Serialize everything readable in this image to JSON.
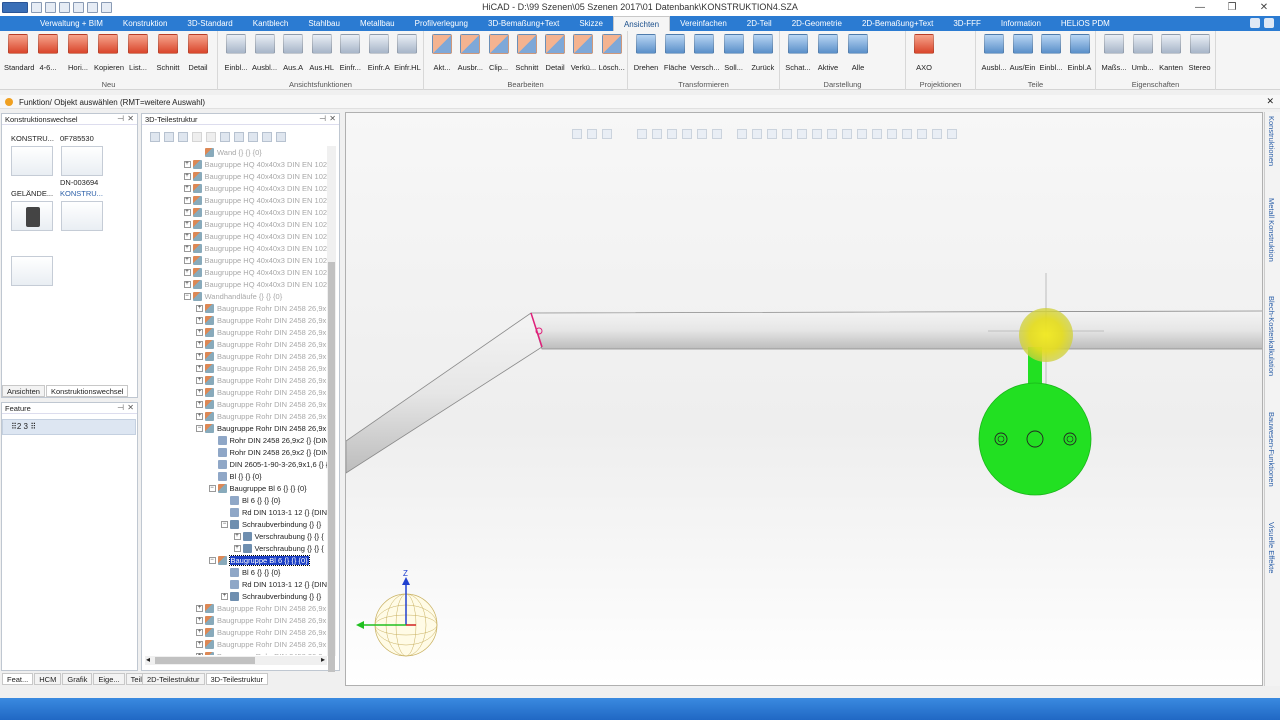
{
  "window": {
    "title": "HiCAD - D:\\99 Szenen\\05 Szenen 2017\\01 Datenbank\\KONSTRUKTION4.SZA",
    "minimize": "—",
    "restore": "❐",
    "close": "✕"
  },
  "ribbon_tabs": [
    {
      "label": "Verwaltung + BIM"
    },
    {
      "label": "Konstruktion"
    },
    {
      "label": "3D-Standard"
    },
    {
      "label": "Kantblech"
    },
    {
      "label": "Stahlbau"
    },
    {
      "label": "Metallbau"
    },
    {
      "label": "Profilverlegung"
    },
    {
      "label": "3D-Bemaßung+Text"
    },
    {
      "label": "Skizze"
    },
    {
      "label": "Ansichten"
    },
    {
      "label": "Vereinfachen"
    },
    {
      "label": "2D-Teil"
    },
    {
      "label": "2D-Geometrie"
    },
    {
      "label": "2D-Bemaßung+Text"
    },
    {
      "label": "3D-FFF"
    },
    {
      "label": "Information"
    },
    {
      "label": "HELiOS PDM"
    }
  ],
  "active_tab": "Ansichten",
  "ribbon_groups": [
    {
      "label": "Neu",
      "buttons": [
        "Standard",
        "4-6...",
        "Hori...",
        "Kopieren",
        "List...",
        "Schnitt",
        "Detail"
      ]
    },
    {
      "label": "Ansichtsfunktionen",
      "buttons": [
        "Einbl...",
        "Ausbl...",
        "Aus.A",
        "Aus.HL",
        "Einfr...",
        "Einfr.A",
        "Einfr.HL"
      ]
    },
    {
      "label": "Bearbeiten",
      "buttons": [
        "Akt...",
        "Ausbr...",
        "Clip...",
        "Schnitt",
        "Detail",
        "Verkü...",
        "Lösch..."
      ]
    },
    {
      "label": "Transformieren",
      "buttons": [
        "Drehen",
        "Fläche",
        "Versch...",
        "Soll...",
        "Zurück"
      ]
    },
    {
      "label": "Darstellung",
      "buttons": [
        "Schat...",
        "Aktive",
        "Alle"
      ]
    },
    {
      "label": "Projektionen",
      "buttons": [
        "AXO"
      ]
    },
    {
      "label": "Teile",
      "buttons": [
        "Ausbl...",
        "Aus/Ein",
        "Einbl...",
        "Einbl.A"
      ]
    },
    {
      "label": "Eigenschaften",
      "buttons": [
        "Maßs...",
        "Umb...",
        "Kanten",
        "Stereo"
      ]
    }
  ],
  "status_message": "Funktion/ Objekt auswählen (RMT=weitere Auswahl)",
  "status_close": "✕",
  "konstruktionswechsel": {
    "title": "Konstruktionswechsel",
    "pin": "⊣",
    "close": "✕",
    "items": [
      {
        "label": "KONSTRU..."
      },
      {
        "label": "0F785530"
      },
      {
        "label": "DN-003694"
      },
      {
        "label": "GELÄNDE..."
      },
      {
        "label": "KONSTRU..."
      }
    ],
    "tabs": [
      "Ansichten",
      "Konstruktionswechsel"
    ]
  },
  "feature": {
    "title": "Feature",
    "pin": "⊣",
    "close": "✕",
    "toolbar": "⠿2 3 ⠿"
  },
  "teilestruktur": {
    "title": "3D-Teilestruktur",
    "pin": "⊣",
    "close": "✕",
    "rows": [
      {
        "text": "Wand {} {} {0}",
        "indent": 2,
        "exp": "",
        "dim": true,
        "icon": "grp"
      },
      {
        "text": "Baugruppe HQ 40x40x3 DIN EN 102",
        "indent": 1,
        "exp": "+",
        "dim": true,
        "icon": "grp"
      },
      {
        "text": "Baugruppe HQ 40x40x3 DIN EN 102",
        "indent": 1,
        "exp": "+",
        "dim": true,
        "icon": "grp"
      },
      {
        "text": "Baugruppe HQ 40x40x3 DIN EN 102",
        "indent": 1,
        "exp": "+",
        "dim": true,
        "icon": "grp"
      },
      {
        "text": "Baugruppe HQ 40x40x3 DIN EN 102",
        "indent": 1,
        "exp": "+",
        "dim": true,
        "icon": "grp"
      },
      {
        "text": "Baugruppe HQ 40x40x3 DIN EN 102",
        "indent": 1,
        "exp": "+",
        "dim": true,
        "icon": "grp"
      },
      {
        "text": "Baugruppe HQ 40x40x3 DIN EN 102",
        "indent": 1,
        "exp": "+",
        "dim": true,
        "icon": "grp"
      },
      {
        "text": "Baugruppe HQ 40x40x3 DIN EN 102",
        "indent": 1,
        "exp": "+",
        "dim": true,
        "icon": "grp"
      },
      {
        "text": "Baugruppe HQ 40x40x3 DIN EN 102",
        "indent": 1,
        "exp": "+",
        "dim": true,
        "icon": "grp"
      },
      {
        "text": "Baugruppe HQ 40x40x3 DIN EN 102",
        "indent": 1,
        "exp": "+",
        "dim": true,
        "icon": "grp"
      },
      {
        "text": "Baugruppe HQ 40x40x3 DIN EN 102",
        "indent": 1,
        "exp": "+",
        "dim": true,
        "icon": "grp"
      },
      {
        "text": "Baugruppe HQ 40x40x3 DIN EN 102",
        "indent": 1,
        "exp": "+",
        "dim": true,
        "icon": "grp"
      },
      {
        "text": "Wandhandläufe {} {} {0}",
        "indent": 1,
        "exp": "−",
        "dim": true,
        "icon": "grp"
      },
      {
        "text": "Baugruppe Rohr DIN 2458 26,9x",
        "indent": 2,
        "exp": "+",
        "dim": true,
        "icon": "grp"
      },
      {
        "text": "Baugruppe Rohr DIN 2458 26,9x",
        "indent": 2,
        "exp": "+",
        "dim": true,
        "icon": "grp"
      },
      {
        "text": "Baugruppe Rohr DIN 2458 26,9x",
        "indent": 2,
        "exp": "+",
        "dim": true,
        "icon": "grp"
      },
      {
        "text": "Baugruppe Rohr DIN 2458 26,9x",
        "indent": 2,
        "exp": "+",
        "dim": true,
        "icon": "grp"
      },
      {
        "text": "Baugruppe Rohr DIN 2458 26,9x",
        "indent": 2,
        "exp": "+",
        "dim": true,
        "icon": "grp"
      },
      {
        "text": "Baugruppe Rohr DIN 2458 26,9x",
        "indent": 2,
        "exp": "+",
        "dim": true,
        "icon": "grp"
      },
      {
        "text": "Baugruppe Rohr DIN 2458 26,9x",
        "indent": 2,
        "exp": "+",
        "dim": true,
        "icon": "grp"
      },
      {
        "text": "Baugruppe Rohr DIN 2458 26,9x",
        "indent": 2,
        "exp": "+",
        "dim": true,
        "icon": "grp"
      },
      {
        "text": "Baugruppe Rohr DIN 2458 26,9x",
        "indent": 2,
        "exp": "+",
        "dim": true,
        "icon": "grp"
      },
      {
        "text": "Baugruppe Rohr DIN 2458 26,9x",
        "indent": 2,
        "exp": "+",
        "dim": true,
        "icon": "grp"
      },
      {
        "text": "Baugruppe Rohr DIN 2458 26,9x",
        "indent": 2,
        "exp": "−",
        "dim": false,
        "icon": "grp"
      },
      {
        "text": "Rohr DIN 2458 26,9x2 {} {DIN",
        "indent": 3,
        "exp": "",
        "dim": false,
        "icon": "part"
      },
      {
        "text": "Rohr DIN 2458 26,9x2 {} {DIN",
        "indent": 3,
        "exp": "",
        "dim": false,
        "icon": "part"
      },
      {
        "text": "DIN 2605-1-90-3-26,9x1,6 {} {",
        "indent": 3,
        "exp": "",
        "dim": false,
        "icon": "part"
      },
      {
        "text": "Bl {} {} {0}",
        "indent": 3,
        "exp": "",
        "dim": false,
        "icon": "part"
      },
      {
        "text": "Baugruppe Bl 6 {} {} {0}",
        "indent": 3,
        "exp": "−",
        "dim": false,
        "icon": "grp"
      },
      {
        "text": "Bl 6 {} {} {0}",
        "indent": 4,
        "exp": "",
        "dim": false,
        "icon": "part"
      },
      {
        "text": "Rd DIN 1013-1 12 {} {DIN",
        "indent": 4,
        "exp": "",
        "dim": false,
        "icon": "part"
      },
      {
        "text": "Schraubverbindung {} {}",
        "indent": 4,
        "exp": "−",
        "dim": false,
        "icon": "bolt"
      },
      {
        "text": "Verschraubung {} {} {",
        "indent": 5,
        "exp": "+",
        "dim": false,
        "icon": "bolt"
      },
      {
        "text": "Verschraubung {} {} {",
        "indent": 5,
        "exp": "+",
        "dim": false,
        "icon": "bolt"
      },
      {
        "text": "Baugruppe Bl 6 {} {} {0}",
        "indent": 3,
        "exp": "−",
        "dim": false,
        "icon": "grp",
        "selected": true
      },
      {
        "text": "Bl 6 {} {} {0}",
        "indent": 4,
        "exp": "",
        "dim": false,
        "icon": "part"
      },
      {
        "text": "Rd DIN 1013-1 12 {} {DIN",
        "indent": 4,
        "exp": "",
        "dim": false,
        "icon": "part"
      },
      {
        "text": "Schraubverbindung {} {}",
        "indent": 4,
        "exp": "+",
        "dim": false,
        "icon": "bolt"
      },
      {
        "text": "Baugruppe Rohr DIN 2458 26,9x",
        "indent": 2,
        "exp": "+",
        "dim": true,
        "icon": "grp"
      },
      {
        "text": "Baugruppe Rohr DIN 2458 26,9x",
        "indent": 2,
        "exp": "+",
        "dim": true,
        "icon": "grp"
      },
      {
        "text": "Baugruppe Rohr DIN 2458 26,9x",
        "indent": 2,
        "exp": "+",
        "dim": true,
        "icon": "grp"
      },
      {
        "text": "Baugruppe Rohr DIN 2458 26,9x",
        "indent": 2,
        "exp": "+",
        "dim": true,
        "icon": "grp"
      },
      {
        "text": "Baugruppe Rohr DIN 2458 26,9x",
        "indent": 2,
        "exp": "+",
        "dim": true,
        "icon": "grp"
      }
    ]
  },
  "bottom_tabs_left": [
    "Feat...",
    "HCM",
    "Grafik",
    "Eige...",
    "Teile..."
  ],
  "bottom_tabs_mid": [
    "2D-Teilestruktur",
    "3D-Teilestruktur"
  ],
  "right_tabs": [
    "Konstruktionen",
    "Metall Konstruktion",
    "Blech-Kostenkalkulation",
    "Bauwesen-Funktionen",
    "Visuelle Effekte"
  ],
  "axis_label": "Z",
  "scroll": {
    "left": "◂",
    "right": "▸",
    "up": "▴",
    "down": "▾"
  },
  "colors": {
    "accent": "#2b7bd2",
    "selection": "#1c3fc5",
    "plate": "#22e022",
    "highlight": "#e8e020",
    "marker": "#e0207a"
  }
}
